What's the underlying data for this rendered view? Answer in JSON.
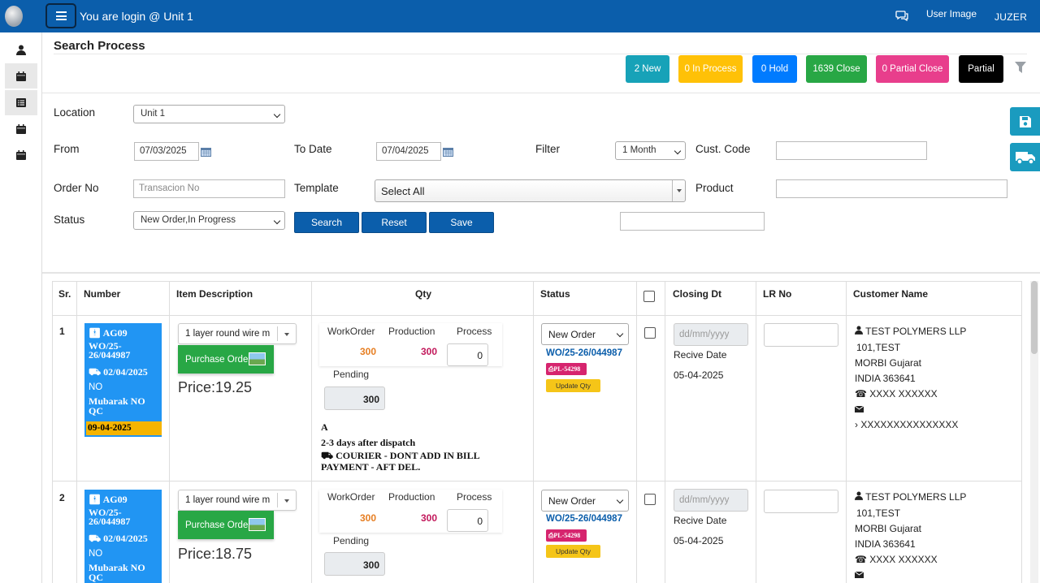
{
  "header": {
    "login_text": "You are login @ Unit 1",
    "user_image_alt": "User Image",
    "user_name": "JUZER"
  },
  "page_title": "Search Process",
  "status_buttons": [
    {
      "label": "2 New",
      "color": "#17a2b8"
    },
    {
      "label": "0 In Process",
      "color": "#ffc107"
    },
    {
      "label": "0 Hold",
      "color": "#007bff"
    },
    {
      "label": "1639 Close",
      "color": "#28a745"
    },
    {
      "label": "0 Partial Close",
      "color": "#e83e8c"
    },
    {
      "label": "Partial",
      "color": "#000000"
    }
  ],
  "form": {
    "location_label": "Location",
    "location_value": "Unit 1",
    "from_label": "From",
    "from_value": "07/03/2025",
    "to_label": "To Date",
    "to_value": "07/04/2025",
    "filter_label": "Filter",
    "filter_value": "1 Month",
    "cust_code_label": "Cust. Code",
    "order_no_label": "Order No",
    "order_no_placeholder": "Transacion No",
    "template_label": "Template",
    "template_value": "Select All",
    "product_label": "Product",
    "status_label": "Status",
    "status_value": "New Order,In Progress",
    "search_label": "Search",
    "reset_label": "Reset",
    "save_label": "Save"
  },
  "table": {
    "headers": {
      "sr": "Sr.",
      "number": "Number",
      "item": "Item Description",
      "qty": "Qty",
      "status": "Status",
      "closing": "Closing Dt",
      "lr": "LR No",
      "customer": "Customer Name"
    },
    "qty_labels": {
      "workorder": "WorkOrder",
      "production": "Production",
      "process": "Process",
      "pending": "Pending"
    },
    "rows": [
      {
        "sr": "1",
        "ag": "AG09",
        "wo": "WO/25-26/044987",
        "date": "02/04/2025",
        "no": "NO",
        "name": "Mubarak NO QC",
        "bar_date": "09-04-2025",
        "item": "1 layer round wire m",
        "po_label": "Purchase Order",
        "price": "Price:19.25",
        "workorder": "300",
        "production": "300",
        "process": "0",
        "pending": "300",
        "note_a": "A",
        "note_days": "2-3 days after dispatch",
        "note_courier": "COURIER - DONT ADD IN BILL PAYMENT - AFT DEL.",
        "status": "New Order",
        "wo_link": "WO/25-26/044987",
        "pl": "PL-54298",
        "update_label": "Update Qty",
        "closing_placeholder": "dd/mm/yyyy",
        "recive_label": "Recive Date",
        "recive_date": "05-04-2025",
        "customer": "TEST POLYMERS LLP",
        "addr1": "101,TEST",
        "addr2": "MORBI Gujarat",
        "addr3": "INDIA 363641",
        "phone": "XXXX XXXXXX",
        "gst": "XXXXXXXXXXXXXXX"
      },
      {
        "sr": "2",
        "ag": "AG09",
        "wo": "WO/25-26/044987",
        "date": "02/04/2025",
        "no": "NO",
        "name": "Mubarak NO QC",
        "item": "1 layer round wire m",
        "po_label": "Purchase Order",
        "price": "Price:18.75",
        "workorder": "300",
        "production": "300",
        "process": "0",
        "pending": "300",
        "status": "New Order",
        "wo_link": "WO/25-26/044987",
        "pl": "PL-54298",
        "update_label": "Update Qty",
        "closing_placeholder": "dd/mm/yyyy",
        "recive_label": "Recive Date",
        "recive_date": "05-04-2025",
        "customer": "TEST POLYMERS LLP",
        "addr1": "101,TEST",
        "addr2": "MORBI Gujarat",
        "addr3": "INDIA 363641",
        "phone": "XXXX XXXXXX"
      }
    ]
  },
  "colors": {
    "header": "#0b5eab",
    "workorder_qty": "#e67e22",
    "production_qty": "#c2185b",
    "wo_link": "#0b5eab"
  }
}
